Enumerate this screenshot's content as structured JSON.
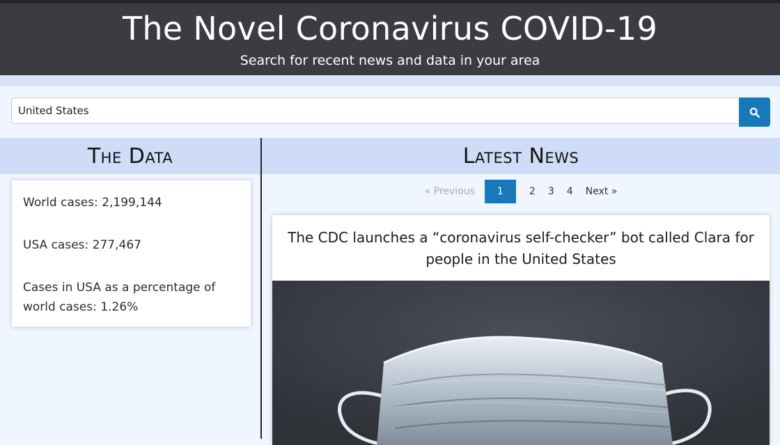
{
  "header": {
    "title": "The Novel Coronavirus COVID-19",
    "subtitle": "Search for recent news and data in your area"
  },
  "search": {
    "value": "United States",
    "button_icon": "search-icon"
  },
  "data_section": {
    "heading": "The Data",
    "stats": [
      "World cases: 2,199,144",
      "USA cases: 277,467",
      "Cases in USA as a percentage of world cases: 1.26%"
    ]
  },
  "news_section": {
    "heading": "Latest News",
    "pagination": {
      "previous": "« Previous",
      "pages": [
        "1",
        "2",
        "3",
        "4"
      ],
      "current": "1",
      "next": "Next »"
    },
    "articles": [
      {
        "title": "The CDC launches a “coronavirus self-checker” bot called Clara for people in the United States",
        "image": "surgical-mask-photo"
      }
    ]
  },
  "colors": {
    "header_bg": "#3a3c41",
    "accent": "#1779ba",
    "section_head_bg": "#cfdcf8",
    "page_bg": "#f0f6ff"
  }
}
